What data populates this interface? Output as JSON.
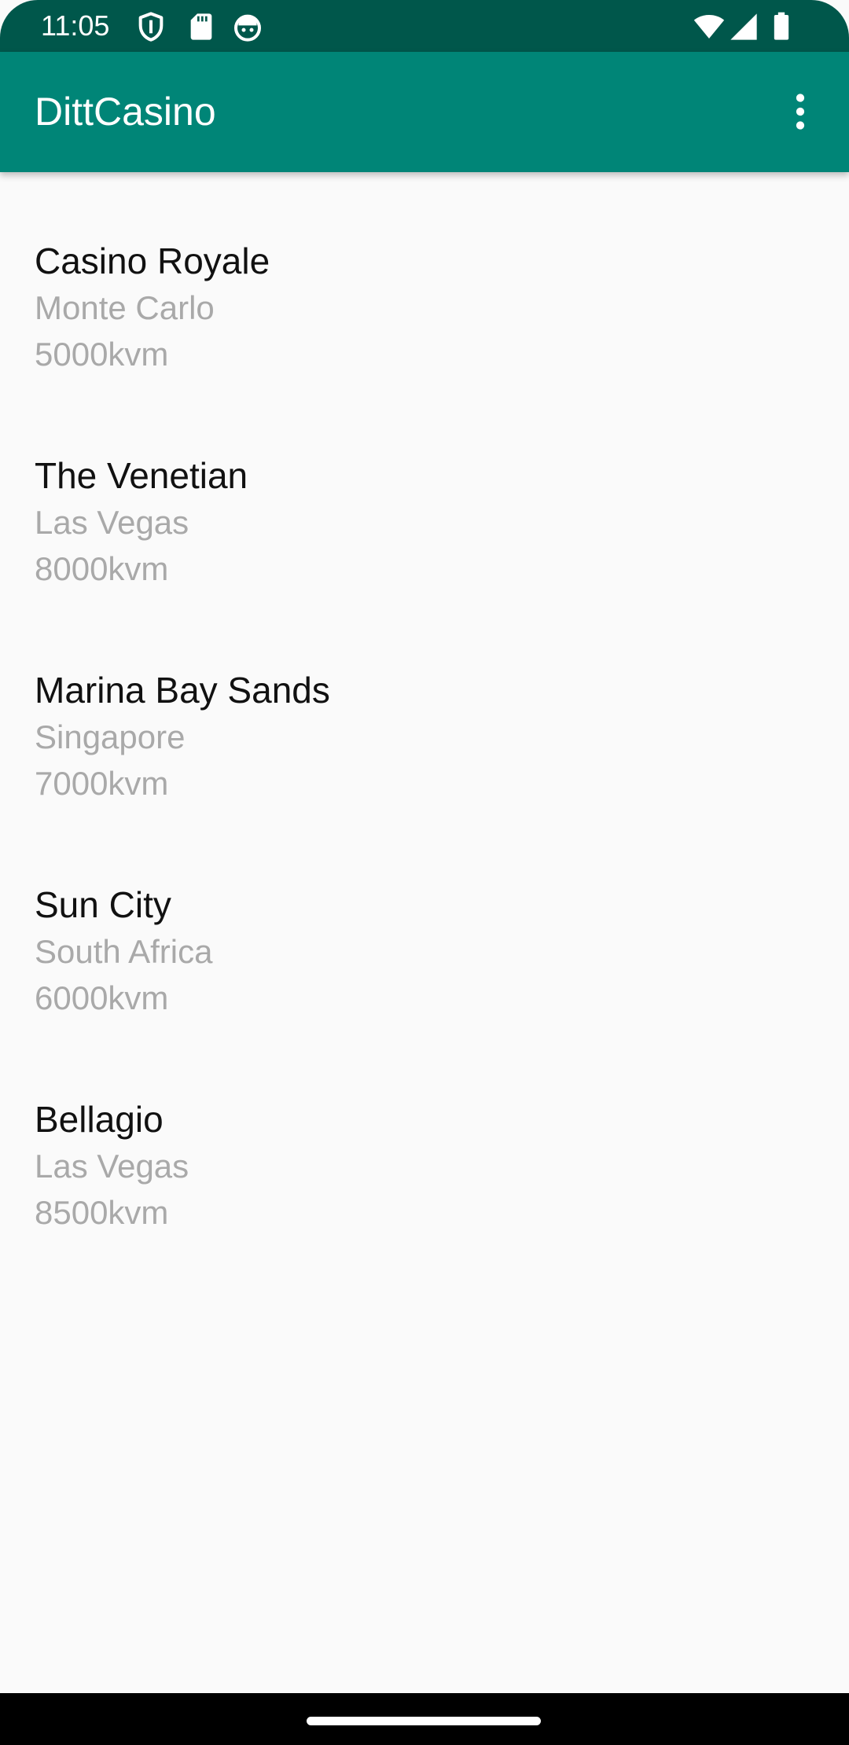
{
  "status_bar": {
    "time": "11:05",
    "left_icons": [
      "shield-icon",
      "sd-card-icon",
      "android-debug-icon"
    ],
    "right_icons": [
      "wifi-icon",
      "cellular-signal-icon",
      "battery-icon"
    ],
    "background": "#00574b"
  },
  "app_bar": {
    "title": "DittCasino",
    "menu_icon": "more-vertical-icon",
    "background": "#008577"
  },
  "casinos": [
    {
      "name": "Casino Royale",
      "location": "Monte Carlo",
      "area": "5000kvm"
    },
    {
      "name": "The Venetian",
      "location": "Las Vegas",
      "area": "8000kvm"
    },
    {
      "name": "Marina Bay Sands",
      "location": "Singapore",
      "area": "7000kvm"
    },
    {
      "name": "Sun City",
      "location": "South Africa",
      "area": "6000kvm"
    },
    {
      "name": "Bellagio",
      "location": "Las Vegas",
      "area": "8500kvm"
    }
  ],
  "colors": {
    "primary": "#008577",
    "primary_dark": "#00574b",
    "text_primary": "#111111",
    "text_secondary": "#a9a9a9",
    "background": "#fafafa"
  }
}
